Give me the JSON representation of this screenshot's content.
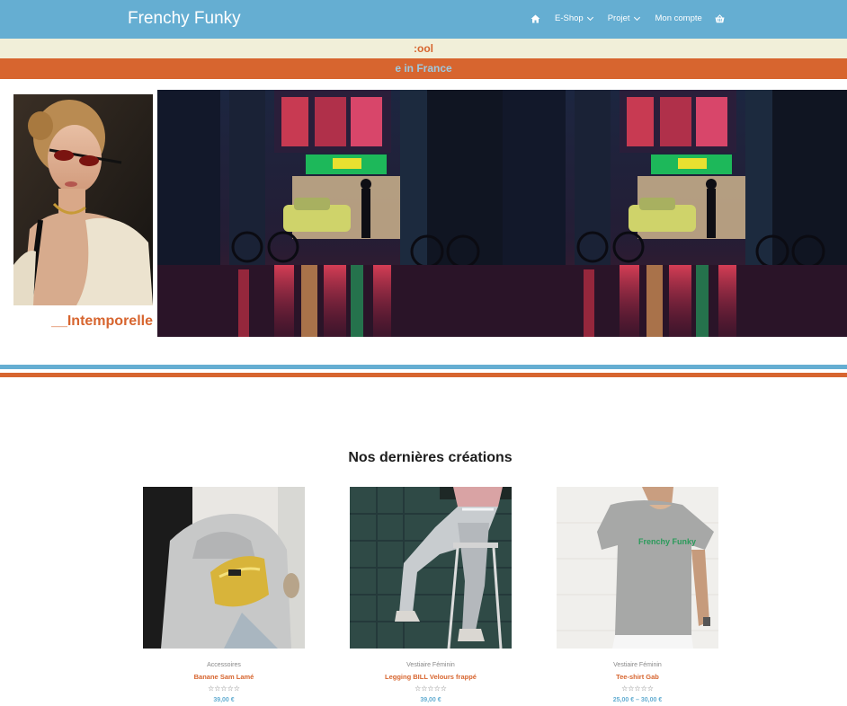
{
  "header": {
    "brand": "Frenchy Funky",
    "nav": {
      "home_icon": "home-icon",
      "eshop": "E-Shop",
      "projet": "Projet",
      "account": "Mon compte",
      "cart_icon": "basket-icon"
    }
  },
  "bands": {
    "cream_text": ":ool",
    "orange_text": "e in France"
  },
  "hero": {
    "caption": "__Intemporelle"
  },
  "products_section": {
    "title": "Nos dernières créations",
    "items": [
      {
        "category": "Accessoires",
        "name": "Banane Sam Lamé",
        "rating": "☆☆☆☆☆",
        "price": "39,00 €"
      },
      {
        "category": "Vestiaire Féminin",
        "name": "Legging BILL Velours frappé",
        "rating": "☆☆☆☆☆",
        "price": "39,00 €"
      },
      {
        "category": "Vestiaire Féminin",
        "name": "Tee-shirt Gab",
        "rating": "☆☆☆☆☆",
        "price": "25,00 € – 30,00 €",
        "shirt_print": "Frenchy Funky"
      }
    ]
  },
  "colors": {
    "blue": "#65aed2",
    "orange": "#d7652f",
    "cream": "#f1efd9"
  }
}
